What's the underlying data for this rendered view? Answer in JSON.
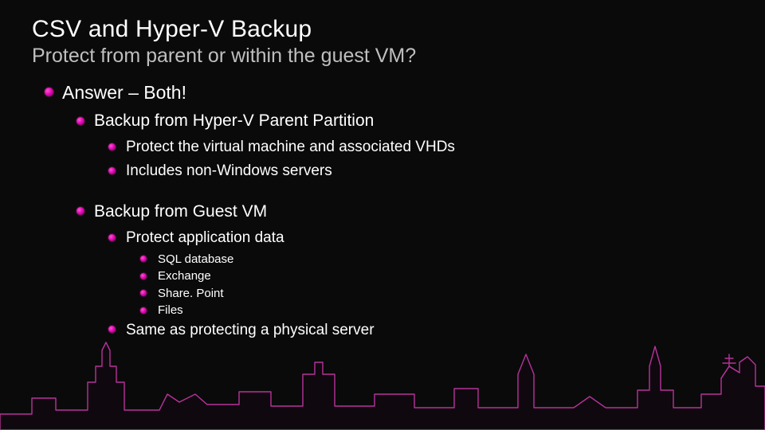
{
  "title": "CSV and Hyper-V Backup",
  "subtitle": "Protect from parent or within the guest VM?",
  "l1_answer": "Answer – Both!",
  "l2_parent": "Backup from Hyper-V Parent Partition",
  "l3_parent_a": "Protect  the virtual machine and associated VHDs",
  "l3_parent_b": "Includes non-Windows servers",
  "l2_guest": "Backup from Guest VM",
  "l3_guest_a": "Protect application data",
  "l4_a": "SQL database",
  "l4_b": "Exchange",
  "l4_c": "Share. Point",
  "l4_d": "Files",
  "l3_guest_b": "Same as protecting a physical server"
}
